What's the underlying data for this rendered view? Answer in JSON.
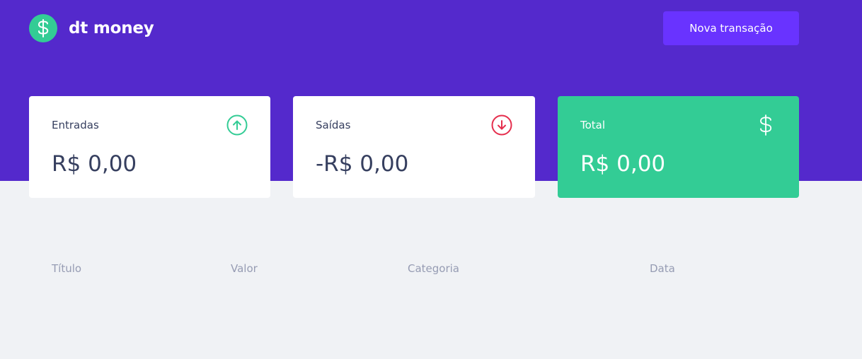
{
  "header": {
    "logo_icon": "dollar-icon",
    "title": "dt money",
    "new_transaction_label": "Nova transação",
    "background_color": "#5429cc",
    "button_color": "#6933ff"
  },
  "summary": {
    "entradas": {
      "label": "Entradas",
      "value": "R$ 0,00",
      "icon": "arrow-up-circle-icon",
      "icon_color": "#33cc95"
    },
    "saidas": {
      "label": "Saídas",
      "value": "-R$ 0,00",
      "icon": "arrow-down-circle-icon",
      "icon_color": "#e52e4d"
    },
    "total": {
      "label": "Total",
      "value": "R$ 0,00",
      "icon": "dollar-icon",
      "background_color": "#33cc95"
    }
  },
  "table": {
    "columns": [
      "Título",
      "Valor",
      "Categoria",
      "Data"
    ],
    "rows": []
  },
  "colors": {
    "page_background": "#f0f2f5",
    "text_title": "#363f5f",
    "text_body": "#969cb3"
  }
}
